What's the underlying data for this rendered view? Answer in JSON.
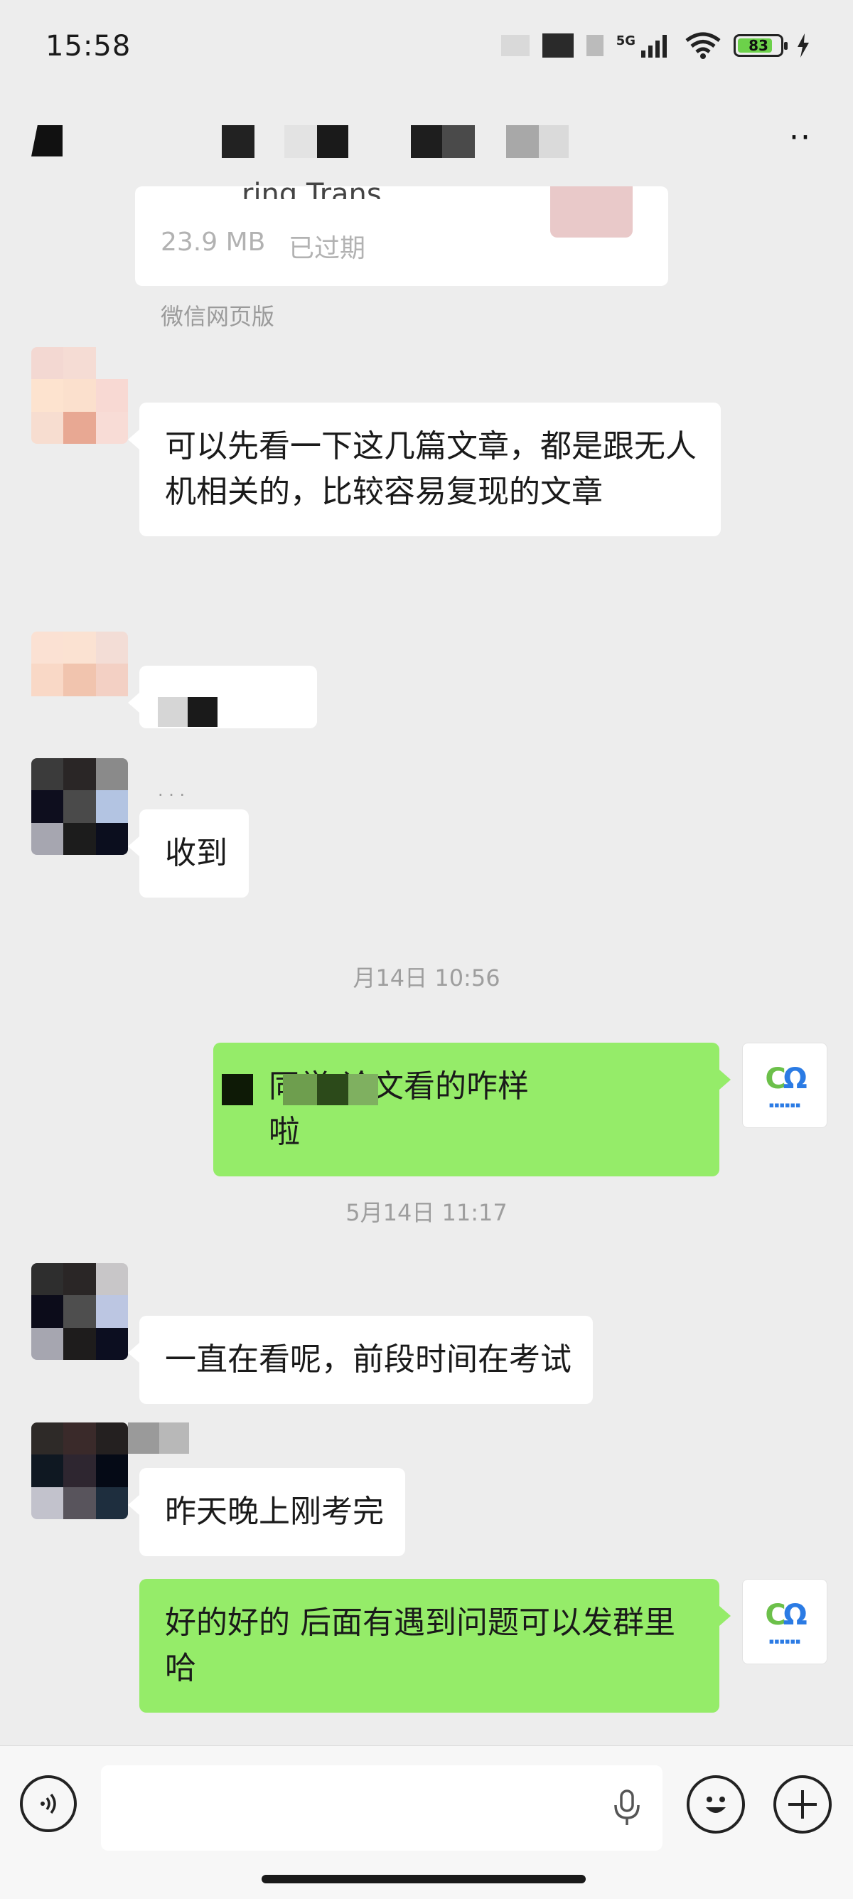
{
  "status_bar": {
    "time": "15:58",
    "network": "5G",
    "battery": "83",
    "battery_level": 0.83,
    "icons": [
      "signal-icon",
      "wifi-icon",
      "battery-icon",
      "charging-icon"
    ]
  },
  "nav": {
    "more_label": "··",
    "icons": [
      "back-icon",
      "more-icon"
    ]
  },
  "file_message": {
    "name_fragment": "ring Trans.",
    "size": "23.9 MB",
    "status": "已过期",
    "source": "微信网页版"
  },
  "messages": [
    {
      "side": "left",
      "text": "可以先看一下这几篇文章，都是跟无人机相关的，比较容易复现的文章"
    },
    {
      "side": "left",
      "text": ""
    },
    {
      "side": "left",
      "text": "收到"
    },
    {
      "side": "right",
      "text": "同学 论文看的咋样啦"
    },
    {
      "side": "left",
      "text": "一直在看呢，前段时间在考试"
    },
    {
      "side": "left",
      "text": "昨天晚上刚考完"
    },
    {
      "side": "right",
      "text": "好的好的 后面有遇到问题可以发群里哈"
    }
  ],
  "timestamps": [
    "月14日 10:56",
    "5月14日 11:17"
  ],
  "input_bar": {
    "placeholder": "",
    "icons": [
      "voice-icon",
      "mic-icon",
      "emoji-icon",
      "plus-icon"
    ]
  },
  "colors": {
    "background": "#ededed",
    "self_bubble": "#95ec69",
    "other_bubble": "#ffffff"
  }
}
